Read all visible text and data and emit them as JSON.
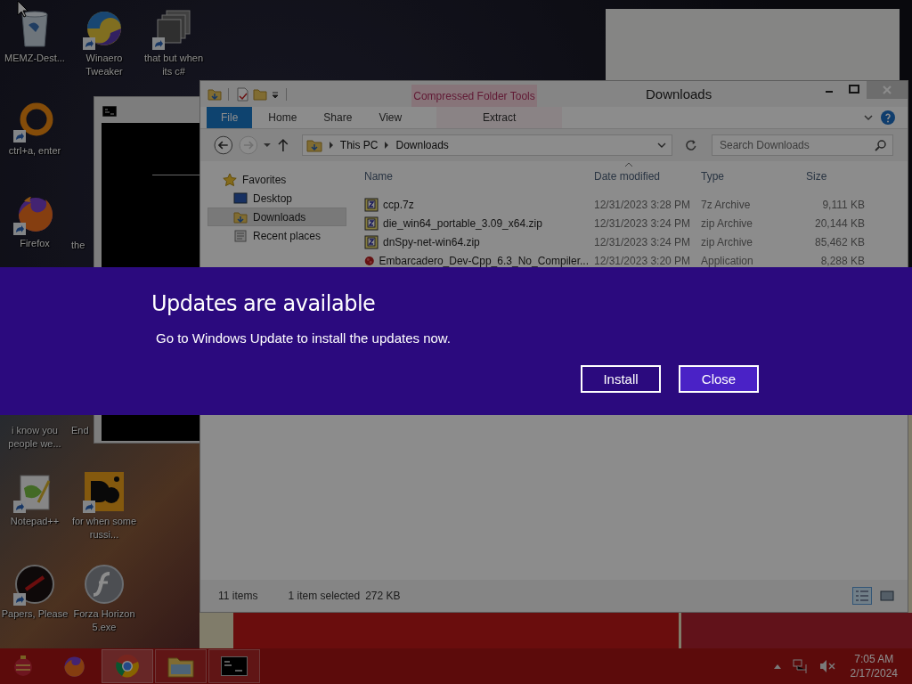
{
  "desktop": {
    "icons": [
      {
        "label": "MEMZ-Dest...",
        "shortcut": false
      },
      {
        "label": "Winaero Tweaker",
        "shortcut": true
      },
      {
        "label": "that but when its c#",
        "shortcut": true
      },
      {
        "label": "ctrl+a, enter",
        "shortcut": true
      },
      {
        "label": "Firefox",
        "shortcut": true
      },
      {
        "label": "the",
        "shortcut": false
      },
      {
        "label": "i know you people we...",
        "shortcut": false
      },
      {
        "label": "End",
        "shortcut": false
      },
      {
        "label": "Notepad++",
        "shortcut": true
      },
      {
        "label": "for when some russi...",
        "shortcut": true
      },
      {
        "label": "Papers, Please",
        "shortcut": true
      },
      {
        "label": "Forza Horizon 5.exe",
        "shortcut": false
      }
    ]
  },
  "explorer": {
    "title": "Downloads",
    "context_tab": "Compressed Folder Tools",
    "ribbon_tabs": [
      {
        "label": "File",
        "kind": "file",
        "selected": false
      },
      {
        "label": "Home",
        "kind": "tab",
        "selected": false
      },
      {
        "label": "Share",
        "kind": "tab",
        "selected": false
      },
      {
        "label": "View",
        "kind": "tab",
        "selected": false
      },
      {
        "label": "Extract",
        "kind": "context",
        "selected": false
      }
    ],
    "forward_enabled": false,
    "path": [
      "This PC",
      "Downloads"
    ],
    "search": {
      "placeholder": "Search Downloads"
    },
    "nav_pane": [
      {
        "label": "Favorites",
        "selected": false,
        "children": [
          {
            "label": "Desktop",
            "selected": false
          },
          {
            "label": "Downloads",
            "selected": true
          },
          {
            "label": "Recent places",
            "selected": false
          }
        ]
      }
    ],
    "columns": [
      "Name",
      "Date modified",
      "Type",
      "Size"
    ],
    "files": [
      {
        "name": "ccp.7z",
        "date": "12/31/2023 3:28 PM",
        "type": "7z Archive",
        "size": "9,111 KB",
        "selected": false
      },
      {
        "name": "die_win64_portable_3.09_x64.zip",
        "date": "12/31/2023 3:24 PM",
        "type": "zip Archive",
        "size": "20,144 KB",
        "selected": false
      },
      {
        "name": "dnSpy-net-win64.zip",
        "date": "12/31/2023 3:24 PM",
        "type": "zip Archive",
        "size": "85,462 KB",
        "selected": false
      },
      {
        "name": "Embarcadero_Dev-Cpp_6.3_No_Compiler...",
        "date": "12/31/2023 3:20 PM",
        "type": "Application",
        "size": "8,288 KB",
        "selected": false
      }
    ],
    "status": {
      "count": "11 items",
      "selection": "1 item selected",
      "selection_size": "272 KB"
    },
    "views": [
      {
        "kind": "details",
        "selected": true
      },
      {
        "kind": "large-icons",
        "selected": false
      }
    ]
  },
  "banner": {
    "title": "Updates are available",
    "message": "Go to Windows Update to install the updates now.",
    "buttons": [
      {
        "label": "Install",
        "focused": false
      },
      {
        "label": "Close",
        "focused": true
      }
    ]
  },
  "taskbar": {
    "apps": [
      {
        "running": false,
        "active": false
      },
      {
        "running": true,
        "active": true
      },
      {
        "running": true,
        "active": false
      },
      {
        "running": true,
        "active": false
      }
    ],
    "volume_muted": true,
    "clock": {
      "time": "7:05 AM",
      "date": "2/17/2024"
    }
  }
}
